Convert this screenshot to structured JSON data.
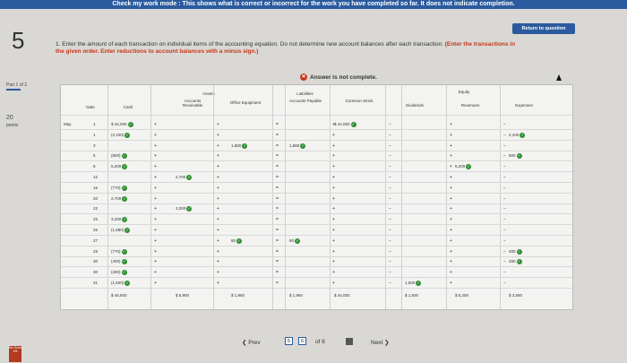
{
  "topbar": "Check my work mode : This shows what is correct or incorrect for the work you have completed so far. It does not indicate completion.",
  "return_btn": "Return to question",
  "question_number": "5",
  "part": "Part 1 of 2",
  "points": {
    "value": "20",
    "label": "points"
  },
  "instruction": "1. Enter the amount of each transaction on individual items of the accounting equation. Do not determine new account balances after each transaction.",
  "instruction_bold": "(Enter the transactions in the given order. Enter reductions to account balances with a minus sign.)",
  "status": "Answer is not complete.",
  "headers": {
    "date": "Date",
    "cash": "Cash",
    "assets": "Assets",
    "ar": "Accounts Receivable",
    "office": "Office Equipment",
    "liabilities": "Liabilities",
    "ap": "Accounts Payable",
    "common": "Common Stock",
    "equity": "Equity",
    "dividends": "Dividends",
    "revenues": "Revenues",
    "expenses": "Expenses"
  },
  "rows": [
    {
      "m": "May",
      "d": "1",
      "cash": "$ 44,000",
      "ar": "",
      "oe": "",
      "ap": "",
      "cs": "$ 44,000",
      "div": "",
      "rev": "",
      "exp": ""
    },
    {
      "m": "",
      "d": "1",
      "cash": "(2,100)",
      "ar": "",
      "oe": "",
      "ap": "",
      "cs": "",
      "div": "",
      "rev": "",
      "exp": "2,100"
    },
    {
      "m": "",
      "d": "3",
      "cash": "",
      "ar": "",
      "oe": "1,880",
      "ap": "1,880",
      "cs": "",
      "div": "",
      "rev": "",
      "exp": ""
    },
    {
      "m": "",
      "d": "5",
      "cash": "(800)",
      "ar": "",
      "oe": "",
      "ap": "",
      "cs": "",
      "div": "",
      "rev": "",
      "exp": "800"
    },
    {
      "m": "",
      "d": "8",
      "cash": "5,200",
      "ar": "",
      "oe": "",
      "ap": "",
      "cs": "",
      "div": "",
      "rev": "5,200",
      "exp": ""
    },
    {
      "m": "",
      "d": "12",
      "cash": "",
      "ar": "2,700",
      "oe": "",
      "ap": "",
      "cs": "",
      "div": "",
      "rev": "",
      "exp": ""
    },
    {
      "m": "",
      "d": "15",
      "cash": "(770)",
      "ar": "",
      "oe": "",
      "ap": "",
      "cs": "",
      "div": "",
      "rev": "",
      "exp": ""
    },
    {
      "m": "",
      "d": "20",
      "cash": "2,700",
      "ar": "",
      "oe": "",
      "ap": "",
      "cs": "",
      "div": "",
      "rev": "",
      "exp": ""
    },
    {
      "m": "",
      "d": "22",
      "cash": "",
      "ar": "3,200",
      "oe": "",
      "ap": "",
      "cs": "",
      "div": "",
      "rev": "",
      "exp": ""
    },
    {
      "m": "",
      "d": "25",
      "cash": "3,200",
      "ar": "",
      "oe": "",
      "ap": "",
      "cs": "",
      "div": "",
      "rev": "",
      "exp": ""
    },
    {
      "m": "",
      "d": "26",
      "cash": "(1,880)",
      "ar": "",
      "oe": "",
      "ap": "",
      "cs": "",
      "div": "",
      "rev": "",
      "exp": ""
    },
    {
      "m": "",
      "d": "27",
      "cash": "",
      "ar": "",
      "oe": "80",
      "ap": "80",
      "cs": "",
      "div": "",
      "rev": "",
      "exp": ""
    },
    {
      "m": "",
      "d": "28",
      "cash": "(770)",
      "ar": "",
      "oe": "",
      "ap": "",
      "cs": "",
      "div": "",
      "rev": "",
      "exp": "400"
    },
    {
      "m": "",
      "d": "30",
      "cash": "(400)",
      "ar": "",
      "oe": "",
      "ap": "",
      "cs": "",
      "div": "",
      "rev": "",
      "exp": "280"
    },
    {
      "m": "",
      "d": "30",
      "cash": "(280)",
      "ar": "",
      "oe": "",
      "ap": "",
      "cs": "",
      "div": "",
      "rev": "",
      "exp": ""
    },
    {
      "m": "",
      "d": "31",
      "cash": "(1,500)",
      "ar": "",
      "oe": "",
      "ap": "",
      "cs": "",
      "div": "1,500",
      "rev": "",
      "exp": ""
    }
  ],
  "totals": {
    "cash": "$ 46,600",
    "ar": "$ 5,900",
    "oe": "$ 1,960",
    "ap": "$ 1,960",
    "cs": "$ 44,000",
    "div": "$ 1,500",
    "rev": "$ 5,200",
    "exp": "$ 3,580"
  },
  "pager": {
    "prev": "Prev",
    "cur": "5",
    "next_page": "6",
    "of": "of 6",
    "next": "Next"
  },
  "logo": "Mc Graw Hill"
}
